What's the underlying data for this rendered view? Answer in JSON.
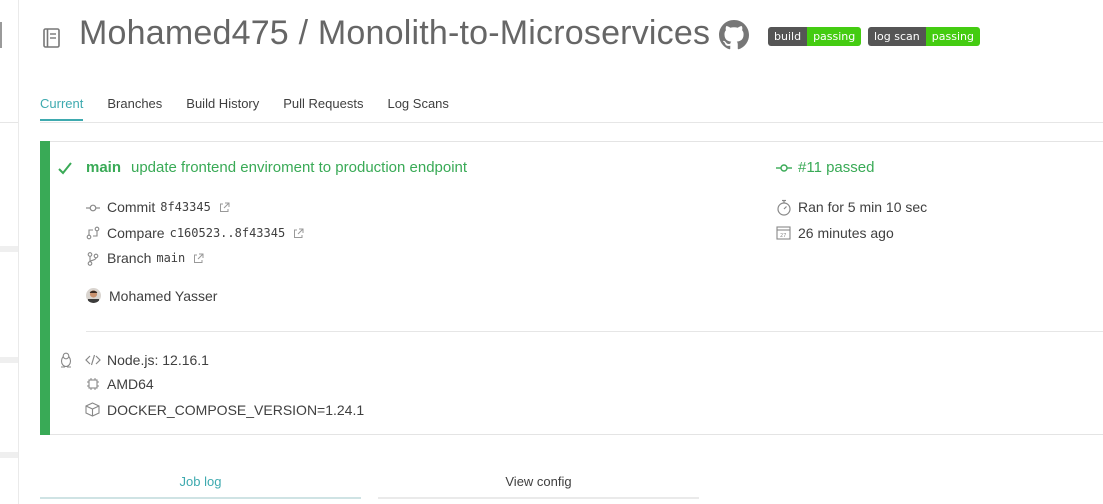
{
  "repo": {
    "title": "Mohamed475 / Monolith-to-Microservices"
  },
  "badges": [
    {
      "key": "build",
      "value": "passing"
    },
    {
      "key": "log scan",
      "value": "passing"
    }
  ],
  "tabs": [
    "Current",
    "Branches",
    "Build History",
    "Pull Requests",
    "Log Scans"
  ],
  "build": {
    "status": "passed",
    "branch": "main",
    "message": "update frontend enviroment to production endpoint",
    "number_label": "#11 passed",
    "commit_label": "Commit",
    "commit_sha": "8f43345",
    "compare_label": "Compare",
    "compare_range": "c160523..8f43345",
    "branch_label": "Branch",
    "branch_value": "main",
    "author": "Mohamed Yasser",
    "duration": "Ran for 5 min 10 sec",
    "time_ago": "26 minutes ago"
  },
  "job": {
    "language": "Node.js: 12.16.1",
    "arch": "AMD64",
    "env": "DOCKER_COMPOSE_VERSION=1.24.1"
  },
  "bottom_tabs": {
    "job_log": "Job log",
    "view_config": "View config"
  },
  "colors": {
    "passed": "#39aa56",
    "accent": "#3eaaaf"
  }
}
